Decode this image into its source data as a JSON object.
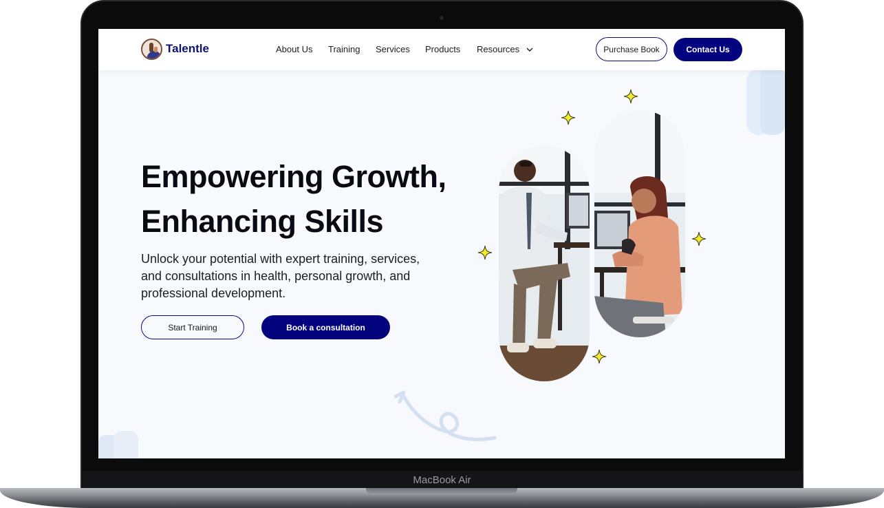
{
  "device": {
    "label": "MacBook Air"
  },
  "header": {
    "logo_text": "Talentle",
    "nav": [
      {
        "label": "About Us"
      },
      {
        "label": "Training"
      },
      {
        "label": "Services"
      },
      {
        "label": "Products"
      },
      {
        "label": "Resources",
        "has_dropdown": true
      }
    ],
    "purchase_label": "Purchase Book",
    "contact_label": "Contact Us"
  },
  "hero": {
    "title_line1": "Empowering Growth,",
    "title_line2": "Enhancing Skills",
    "subtitle": "Unlock your potential with expert training, services, and consultations in health, personal growth, and professional development.",
    "start_label": "Start Training",
    "book_label": "Book a consultation"
  },
  "colors": {
    "brand_navy": "#05047f",
    "sparkle_yellow": "#f2ea2a",
    "page_bg": "#f7f9fd"
  },
  "icons": {
    "logo": "thumbs-up-person-icon",
    "dropdown": "chevron-down-icon",
    "sparkle": "four-point-star-icon",
    "decor_arrow": "curly-arrow-icon"
  }
}
